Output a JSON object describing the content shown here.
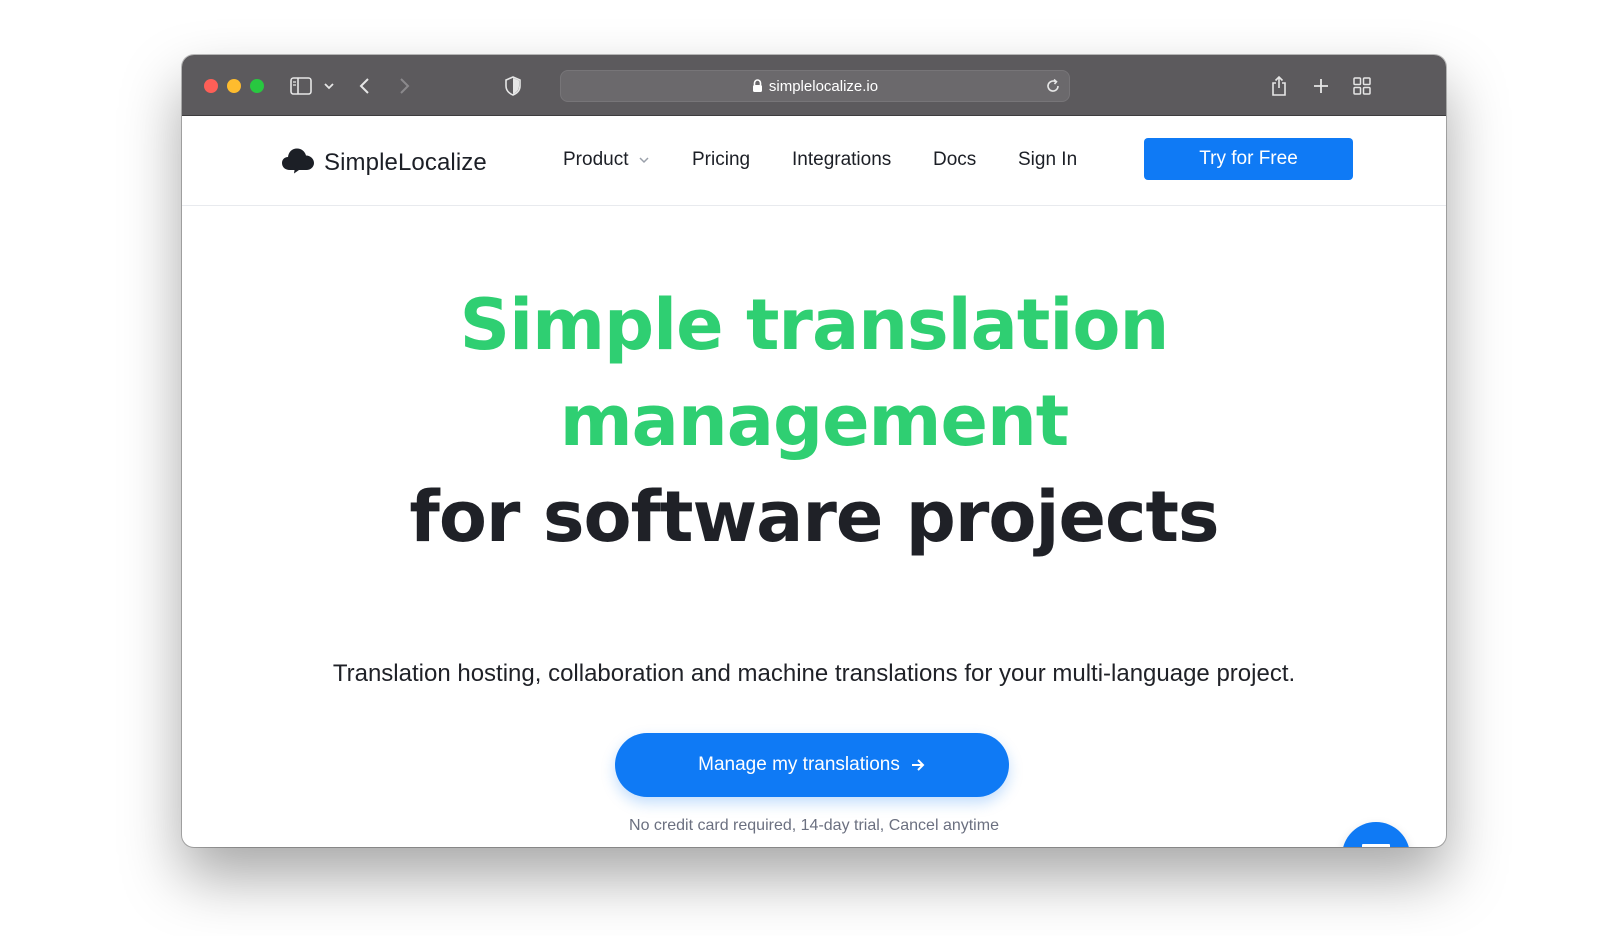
{
  "browser": {
    "url": "simplelocalize.io",
    "icons": [
      "sidebar-icon",
      "chevron-down-icon",
      "back-icon",
      "forward-icon",
      "shield-icon",
      "lock-icon",
      "reload-icon",
      "share-icon",
      "new-tab-icon",
      "tab-overview-icon"
    ]
  },
  "navbar": {
    "brand": "SimpleLocalize",
    "items": [
      {
        "label": "Product"
      },
      {
        "label": "Pricing"
      },
      {
        "label": "Integrations"
      },
      {
        "label": "Docs"
      },
      {
        "label": "Sign In"
      }
    ],
    "cta": "Try for Free"
  },
  "hero": {
    "headline_line1": "Simple translation",
    "headline_line2": "management",
    "headline_line3": "for software projects",
    "subtitle": "Translation hosting, collaboration and machine translations for your multi-language project.",
    "cta": "Manage my translations",
    "note": "No credit card required, 14-day trial, Cancel anytime"
  },
  "colors": {
    "accent": "#0f7af5",
    "headline_green": "#2fcf72",
    "text_dark": "#1f2127",
    "note_gray": "#6b7080"
  }
}
